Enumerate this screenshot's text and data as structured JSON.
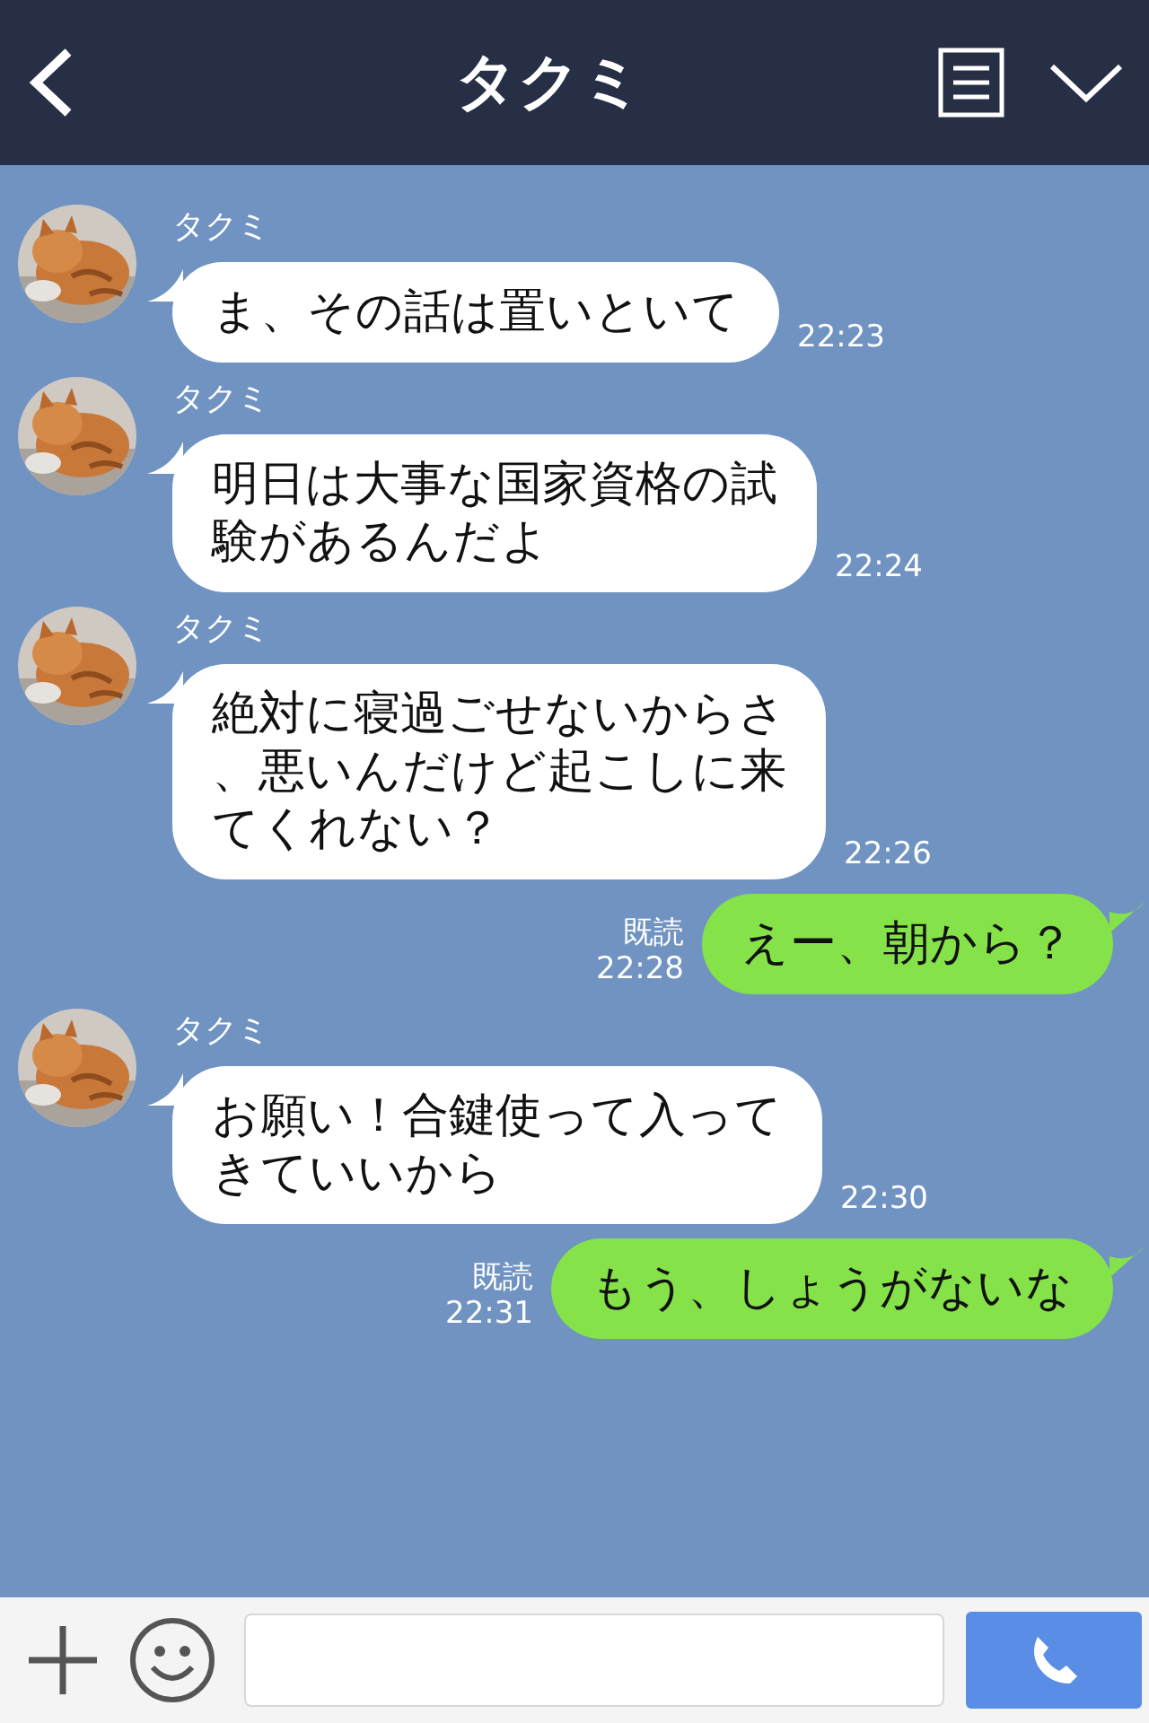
{
  "header": {
    "title": "タクミ"
  },
  "messages": [
    {
      "kind": "received",
      "sender": "タクミ",
      "lines": [
        "ま、その話は置いといて"
      ],
      "time": "22:23"
    },
    {
      "kind": "received",
      "sender": "タクミ",
      "lines": [
        "明日は大事な国家資格の試",
        "験があるんだよ"
      ],
      "time": "22:24"
    },
    {
      "kind": "received",
      "sender": "タクミ",
      "lines": [
        "絶対に寝過ごせないからさ",
        "、悪いんだけど起こしに来",
        "てくれない？"
      ],
      "time": "22:26"
    },
    {
      "kind": "sent",
      "read": "既読",
      "lines": [
        "えー、朝から？"
      ],
      "time": "22:28"
    },
    {
      "kind": "received",
      "sender": "タクミ",
      "lines": [
        "お願い！合鍵使って入って",
        "きていいから"
      ],
      "time": "22:30"
    },
    {
      "kind": "sent",
      "read": "既読",
      "lines": [
        "もう、しょうがないな"
      ],
      "time": "22:31"
    }
  ]
}
